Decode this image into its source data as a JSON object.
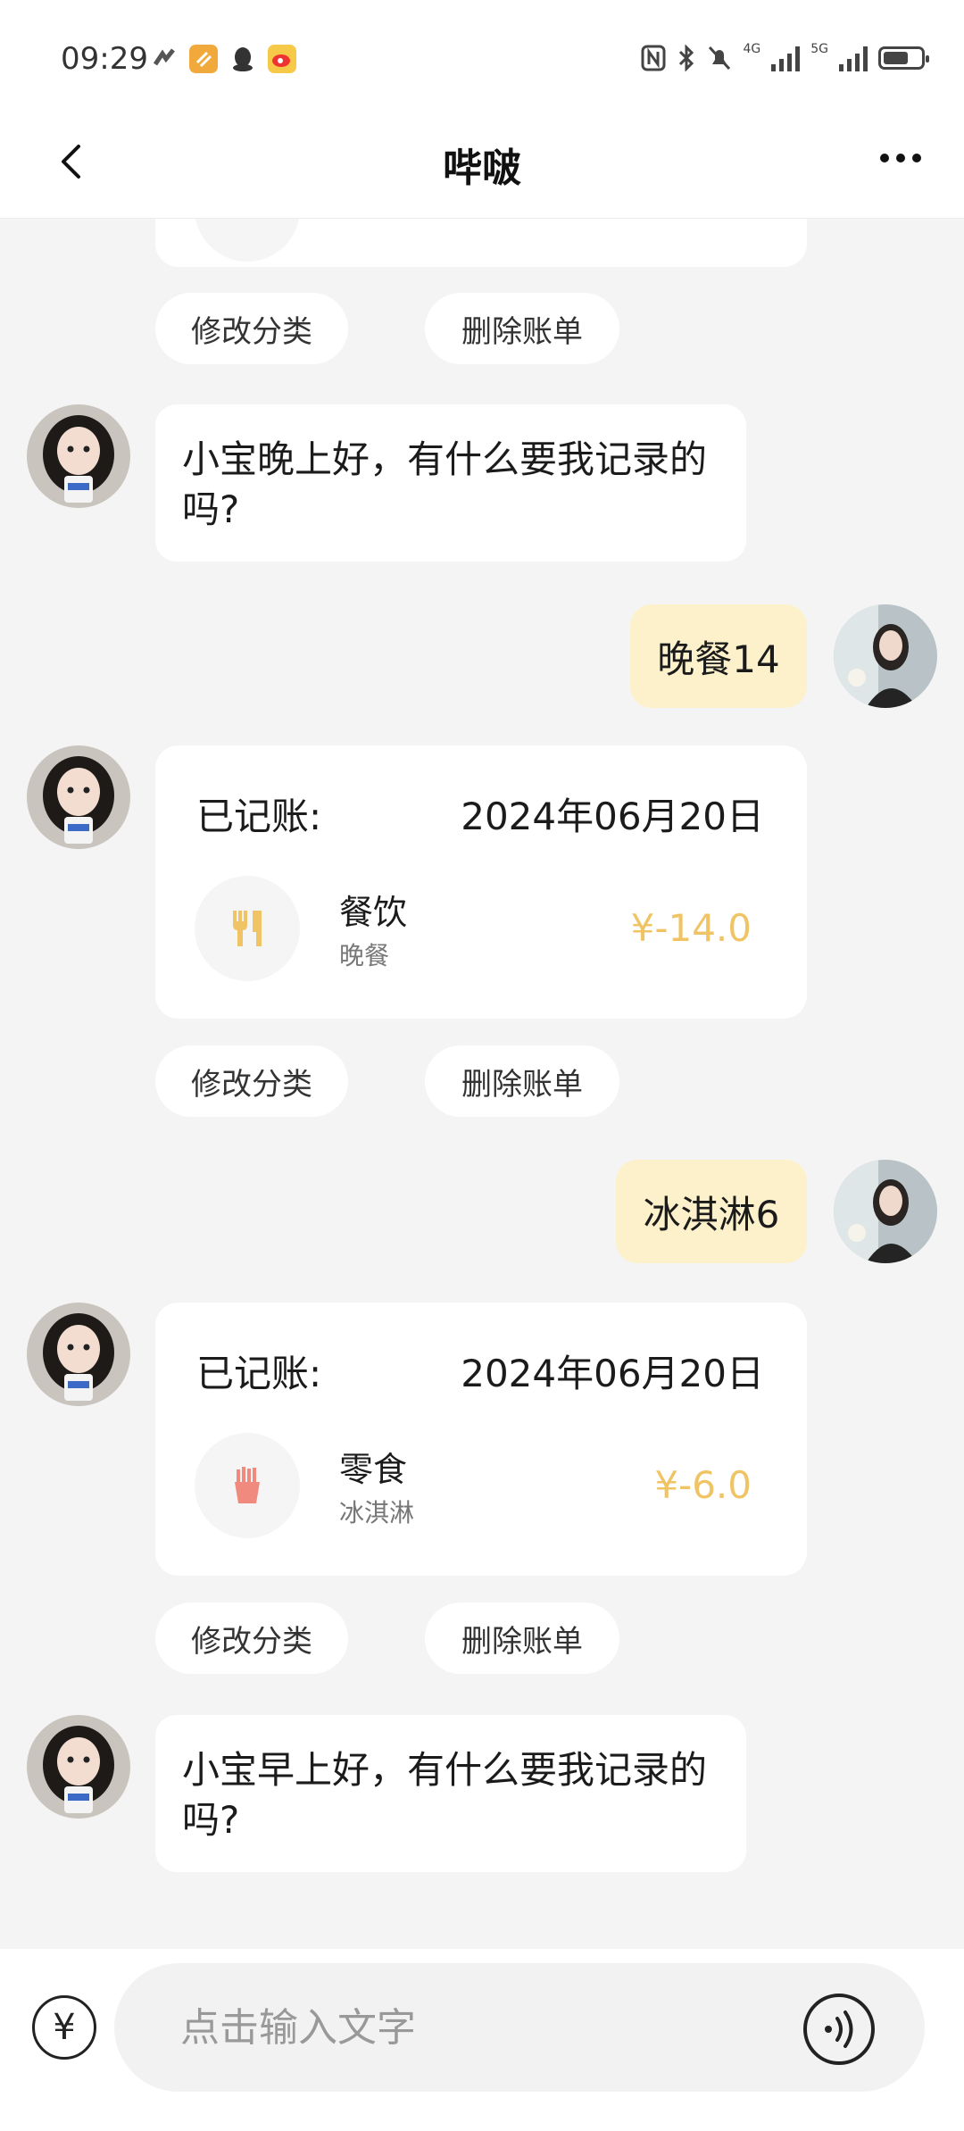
{
  "status_bar": {
    "time": "09:29",
    "network_1": "4G",
    "network_2": "5G",
    "battery_level": 0.58
  },
  "header": {
    "title": "哔啵"
  },
  "messages": {
    "top_actions": {
      "edit_label": "修改分类",
      "delete_label": "删除账单"
    },
    "greeting_evening": "小宝晚上好，有什么要我记录的吗?",
    "user_msg_1": "晚餐14",
    "record_1": {
      "label": "已记账:",
      "date": "2024年06月20日",
      "category": "餐饮",
      "note": "晚餐",
      "amount": "¥-14.0",
      "icon": "utensils-icon",
      "edit_label": "修改分类",
      "delete_label": "删除账单"
    },
    "user_msg_2": "冰淇淋6",
    "record_2": {
      "label": "已记账:",
      "date": "2024年06月20日",
      "category": "零食",
      "note": "冰淇淋",
      "amount": "¥-6.0",
      "icon": "fries-icon",
      "edit_label": "修改分类",
      "delete_label": "删除账单"
    },
    "greeting_morning": "小宝早上好，有什么要我记录的吗?"
  },
  "input_bar": {
    "currency_symbol": "¥",
    "placeholder": "点击输入文字"
  },
  "colors": {
    "amount": "#f0c465",
    "user_bubble": "#fdf1cc",
    "fries": "#f08a7e",
    "utensils": "#f0c465"
  }
}
